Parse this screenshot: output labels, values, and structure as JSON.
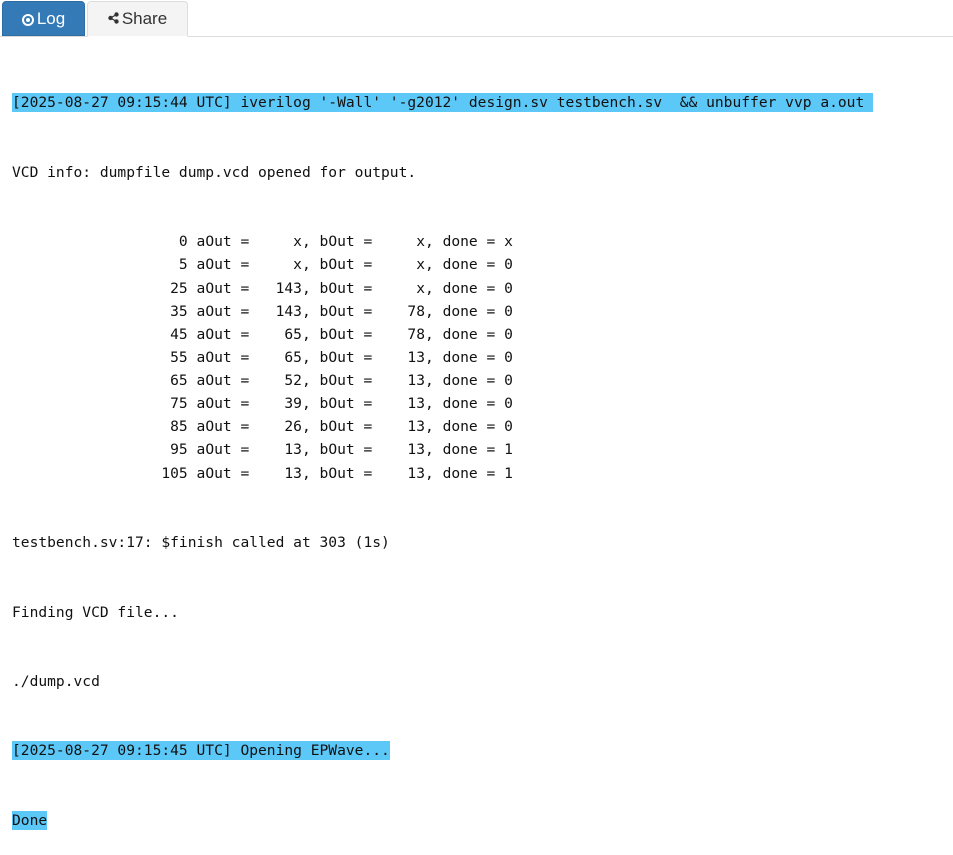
{
  "tabs": {
    "log_label": "Log",
    "share_label": "Share",
    "log_icon": "record-circle-icon",
    "share_icon": "share-nodes-icon"
  },
  "accent": "#337ab7",
  "highlight": "#5bc8f8",
  "log": {
    "command_line": "[2025-08-27 09:15:44 UTC] iverilog '-Wall' '-g2012' design.sv testbench.sv  && unbuffer vvp a.out ",
    "vcd_info": "VCD info: dumpfile dump.vcd opened for output.",
    "results": [
      {
        "time": "0",
        "aOut_label": "aOut =",
        "aOut": "x",
        "bOut_label": "bOut =",
        "bOut": "x",
        "done_label": "done =",
        "done": "x"
      },
      {
        "time": "5",
        "aOut_label": "aOut =",
        "aOut": "x",
        "bOut_label": "bOut =",
        "bOut": "x",
        "done_label": "done =",
        "done": "0"
      },
      {
        "time": "25",
        "aOut_label": "aOut =",
        "aOut": "143",
        "bOut_label": "bOut =",
        "bOut": "x",
        "done_label": "done =",
        "done": "0"
      },
      {
        "time": "35",
        "aOut_label": "aOut =",
        "aOut": "143",
        "bOut_label": "bOut =",
        "bOut": "78",
        "done_label": "done =",
        "done": "0"
      },
      {
        "time": "45",
        "aOut_label": "aOut =",
        "aOut": "65",
        "bOut_label": "bOut =",
        "bOut": "78",
        "done_label": "done =",
        "done": "0"
      },
      {
        "time": "55",
        "aOut_label": "aOut =",
        "aOut": "65",
        "bOut_label": "bOut =",
        "bOut": "13",
        "done_label": "done =",
        "done": "0"
      },
      {
        "time": "65",
        "aOut_label": "aOut =",
        "aOut": "52",
        "bOut_label": "bOut =",
        "bOut": "13",
        "done_label": "done =",
        "done": "0"
      },
      {
        "time": "75",
        "aOut_label": "aOut =",
        "aOut": "39",
        "bOut_label": "bOut =",
        "bOut": "13",
        "done_label": "done =",
        "done": "0"
      },
      {
        "time": "85",
        "aOut_label": "aOut =",
        "aOut": "26",
        "bOut_label": "bOut =",
        "bOut": "13",
        "done_label": "done =",
        "done": "0"
      },
      {
        "time": "95",
        "aOut_label": "aOut =",
        "aOut": "13",
        "bOut_label": "bOut =",
        "bOut": "13",
        "done_label": "done =",
        "done": "1"
      },
      {
        "time": "105",
        "aOut_label": "aOut =",
        "aOut": "13",
        "bOut_label": "bOut =",
        "bOut": "13",
        "done_label": "done =",
        "done": "1"
      }
    ],
    "finish_line": "testbench.sv:17: $finish called at 303 (1s)",
    "finding_line": "Finding VCD file...",
    "dump_path": "./dump.vcd",
    "opening_line": "[2025-08-27 09:15:45 UTC] Opening EPWave...",
    "done_line": "Done"
  }
}
